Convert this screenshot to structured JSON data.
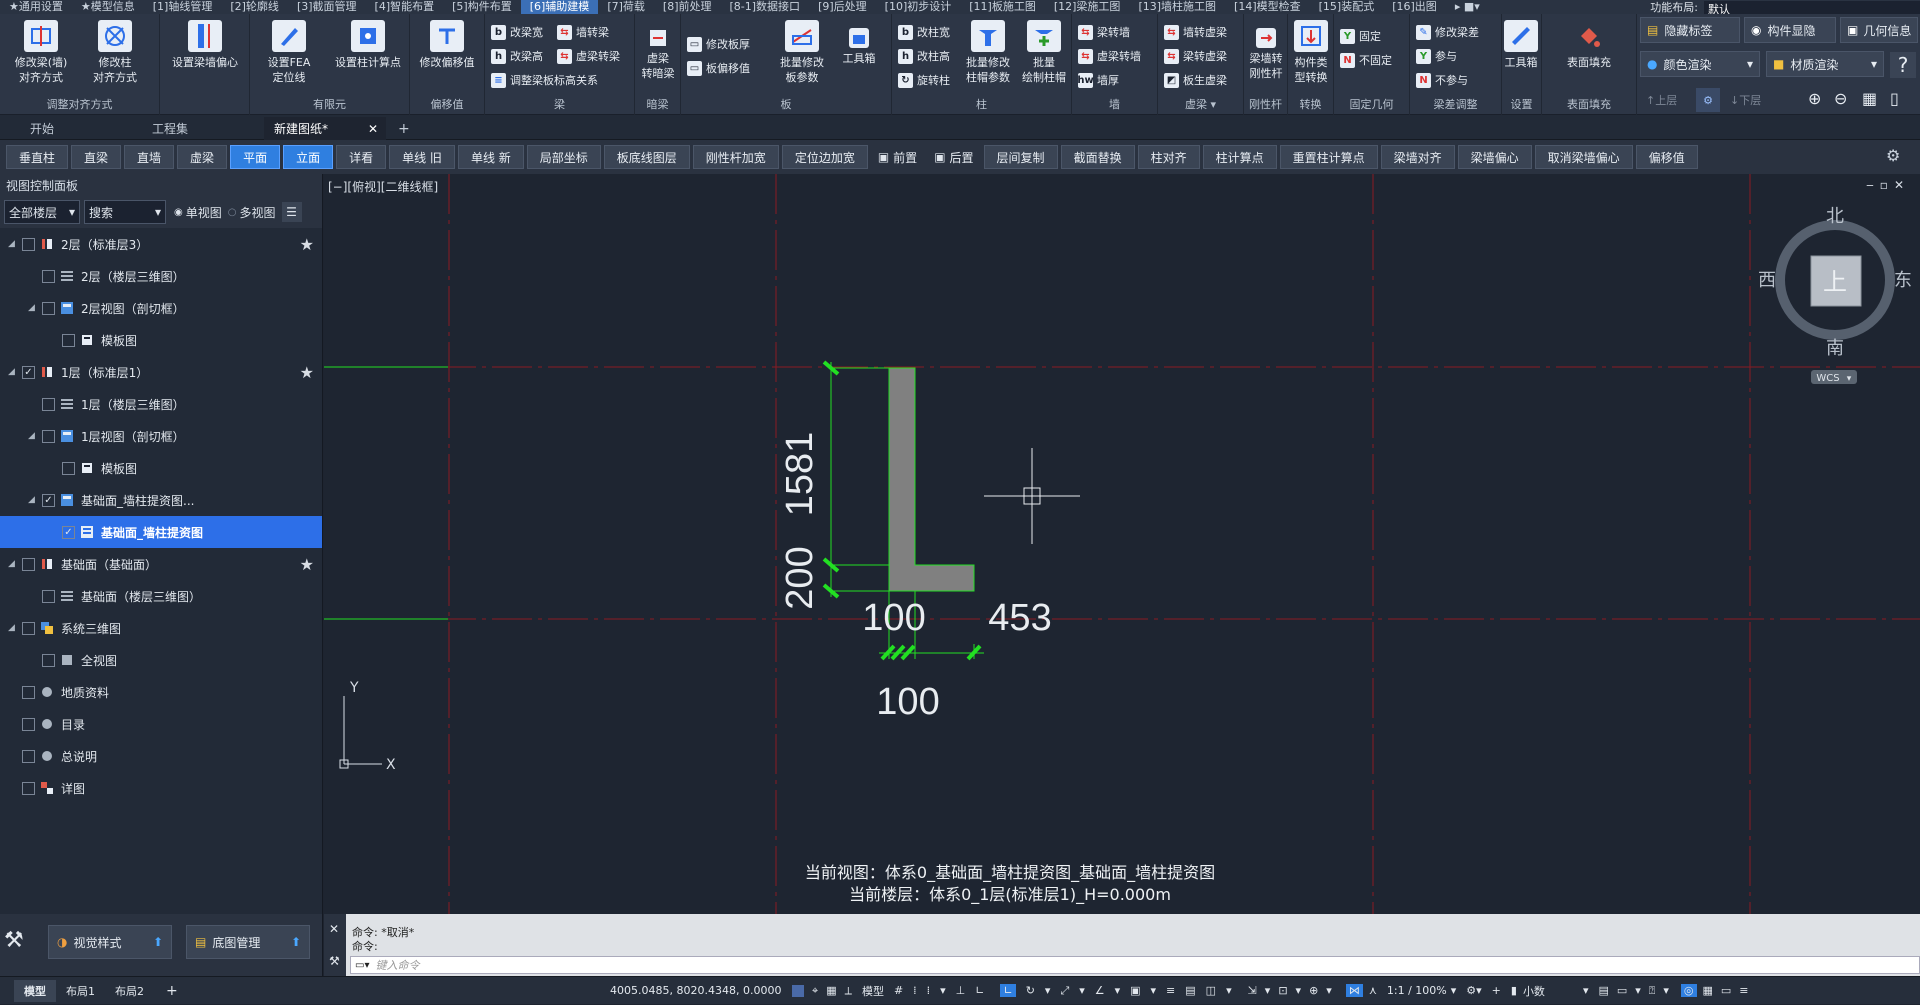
{
  "menubar": {
    "items": [
      "★通用设置",
      "★模型信息",
      "[1]轴线管理",
      "[2]轮廓线",
      "[3]截面管理",
      "[4]智能布置",
      "[5]构件布置",
      "[6]辅助建模",
      "[7]荷载",
      "[8]前处理",
      "[8-1]数据接口",
      "[9]后处理",
      "[10]初步设计",
      "[11]板施工图",
      "[12]梁施工图",
      "[13]墙柱施工图",
      "[14]模型检查",
      "[15]装配式",
      "[16]出图"
    ],
    "active_index": 7,
    "layout_label": "功能布局:",
    "layout_value": "默认"
  },
  "ribbon": {
    "g1": {
      "b1": "修改梁(墙)\n对齐方式",
      "b2": "修改柱\n对齐方式",
      "label": "调整对齐方式"
    },
    "g2": {
      "b1": "设置梁墙偏心",
      "label": ""
    },
    "g3": {
      "b1": "设置FEA\n定位线",
      "b2": "设置柱计算点",
      "label": "有限元"
    },
    "g4": {
      "b1": "修改偏移值",
      "label": "偏移值"
    },
    "g5": {
      "s1": "改梁宽",
      "s2": "改梁高",
      "s3": "调整梁板标高关系",
      "s4": "墙转梁",
      "s5": "虚梁转梁",
      "label": "梁"
    },
    "g6": {
      "b1": "虚梁\n转暗梁",
      "label": "暗梁"
    },
    "g7": {
      "s1": "修改板厚",
      "s2": "板偏移值",
      "b1": "批量修改\n板参数",
      "b2": "工具箱",
      "label": "板"
    },
    "g8": {
      "s1": "改柱宽",
      "s2": "改柱高",
      "s3": "旋转柱",
      "b1": "批量修改\n柱帽参数",
      "b2": "批量\n绘制柱帽",
      "label": "柱"
    },
    "g9": {
      "s1": "梁转墙",
      "s2": "虚梁转墙",
      "s3": "墙厚",
      "label": "墙"
    },
    "g10": {
      "s1": "墙转虚梁",
      "s2": "梁转虚梁",
      "s3": "板生虚梁",
      "label": "虚梁"
    },
    "g11": {
      "b1": "梁墙转\n刚性杆",
      "label": "刚性杆"
    },
    "g12": {
      "b1": "构件类\n型转换",
      "label": "转换"
    },
    "g13": {
      "s1": "固定",
      "s2": "不固定",
      "label": "固定几何"
    },
    "g14": {
      "s1": "修改梁差",
      "s2": "参与",
      "s3": "不参与",
      "label": "梁差调整"
    },
    "g15": {
      "b1": "工具箱",
      "label": "设置"
    },
    "g16": {
      "b1": "表面填充",
      "label": "表面填充"
    },
    "right": {
      "hide_tag": "隐藏标签",
      "comp_show": "构件显隐",
      "geo_info": "几何信息",
      "color_render": "颜色渲染",
      "mat_render": "材质渲染",
      "up_floor": "上层",
      "down_floor": "下层"
    }
  },
  "doctabs": {
    "t1": "开始",
    "t2": "工程集",
    "t3": "新建图纸*"
  },
  "toolbar": [
    "垂直柱",
    "直梁",
    "直墙",
    "虚梁",
    "平面",
    "立面",
    "详看",
    "单线 旧",
    "单线 新",
    "局部坐标",
    "板底线图层",
    "刚性杆加宽",
    "定位边加宽",
    "前置",
    "后置",
    "层间复制",
    "截面替换",
    "柱对齐",
    "柱计算点",
    "重置柱计算点",
    "梁墙对齐",
    "梁墙偏心",
    "取消梁墙偏心",
    "偏移值"
  ],
  "toolbar_active": [
    4,
    5
  ],
  "panel": {
    "title": "视图控制面板",
    "floor_select": "全部楼层",
    "search_placeholder": "搜索",
    "single_view": "单视图",
    "multi_view": "多视图",
    "tree": [
      {
        "label": "2层（标准层3）",
        "level": 0,
        "star": true,
        "expand": true,
        "checked": false,
        "icon": "floor"
      },
      {
        "label": "2层（楼层三维图）",
        "level": 1,
        "checked": false,
        "icon": "grid"
      },
      {
        "label": "2层视图（剖切框）",
        "level": 1,
        "expand": true,
        "checked": false,
        "icon": "view"
      },
      {
        "label": "模板图",
        "level": 2,
        "checked": false,
        "icon": "plan"
      },
      {
        "label": "1层（标准层1）",
        "level": 0,
        "star": true,
        "expand": true,
        "checked": true,
        "icon": "floor"
      },
      {
        "label": "1层（楼层三维图）",
        "level": 1,
        "checked": false,
        "icon": "grid"
      },
      {
        "label": "1层视图（剖切框）",
        "level": 1,
        "expand": true,
        "checked": false,
        "icon": "view"
      },
      {
        "label": "模板图",
        "level": 2,
        "checked": false,
        "icon": "plan"
      },
      {
        "label": "基础面_墙柱提资图...",
        "level": 1,
        "expand": true,
        "checked": true,
        "icon": "view"
      },
      {
        "label": "基础面_墙柱提资图",
        "level": 2,
        "checked": true,
        "selected": true,
        "icon": "doc"
      },
      {
        "label": "基础面（基础面）",
        "level": 0,
        "star": true,
        "expand": true,
        "checked": false,
        "icon": "floor"
      },
      {
        "label": "基础面（楼层三维图）",
        "level": 1,
        "checked": false,
        "icon": "grid"
      },
      {
        "label": "系统三维图",
        "level": 0,
        "expand": true,
        "checked": false,
        "icon": "sys"
      },
      {
        "label": "全视图",
        "level": 1,
        "checked": false,
        "icon": "box"
      },
      {
        "label": "地质资料",
        "level": 0,
        "checked": false,
        "icon": "dot"
      },
      {
        "label": "目录",
        "level": 0,
        "checked": false,
        "icon": "dot"
      },
      {
        "label": "总说明",
        "level": 0,
        "checked": false,
        "icon": "dot"
      },
      {
        "label": "详图",
        "level": 0,
        "checked": false,
        "icon": "detail"
      }
    ],
    "foot_visual": "视觉样式",
    "foot_base": "底图管理"
  },
  "canvas": {
    "view_label": "[−][俯视][二维线框]",
    "dims": {
      "d1581": "1581",
      "d200": "200",
      "d100a": "100",
      "d453": "453",
      "d100b": "100"
    },
    "viewcube": {
      "n": "北",
      "s": "南",
      "e": "东",
      "w": "西",
      "top": "上",
      "wcs": "WCS"
    },
    "ucs": {
      "x": "X",
      "y": "Y"
    },
    "info1": "当前视图：体系0_基础面_墙柱提资图_基础面_墙柱提资图",
    "info2": "当前楼层：体系0_1层(标准层1)_H=0.000m"
  },
  "command": {
    "line1": "命令: *取消*",
    "line2": "命令:",
    "placeholder": "键入命令"
  },
  "status": {
    "tabs": [
      "模型",
      "布局1",
      "布局2"
    ],
    "coords": "4005.0485, 8020.4348, 0.0000",
    "model": "模型",
    "scale": "1:1 / 100%",
    "units": "小数"
  },
  "colors": {
    "accent": "#2f7fe0",
    "dim_green": "#22e022",
    "grid_red": "#8a1a22",
    "wall_gray": "#808080"
  }
}
